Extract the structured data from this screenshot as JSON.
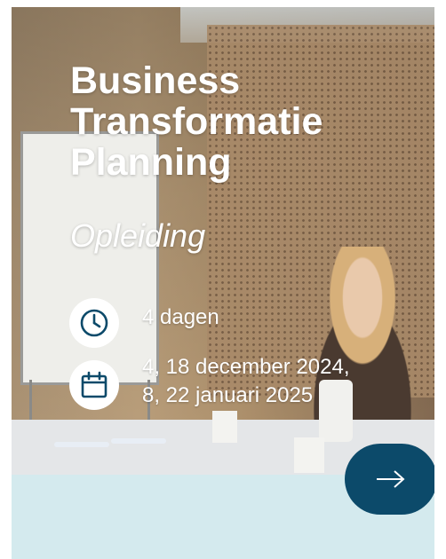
{
  "course": {
    "title_lines": [
      "Business",
      "Transformatie",
      "Planning"
    ],
    "subtitle": "Opleiding"
  },
  "info": {
    "duration": "4 dagen",
    "dates_line1": "4, 18 december 2024,",
    "dates_line2": "8, 22 januari 2025"
  },
  "icons": {
    "duration": "clock-icon",
    "dates": "calendar-icon",
    "next": "arrow-right-icon"
  },
  "colors": {
    "accent": "#0c4a6a",
    "panel": "#d4eaee",
    "text": "#ffffff"
  }
}
